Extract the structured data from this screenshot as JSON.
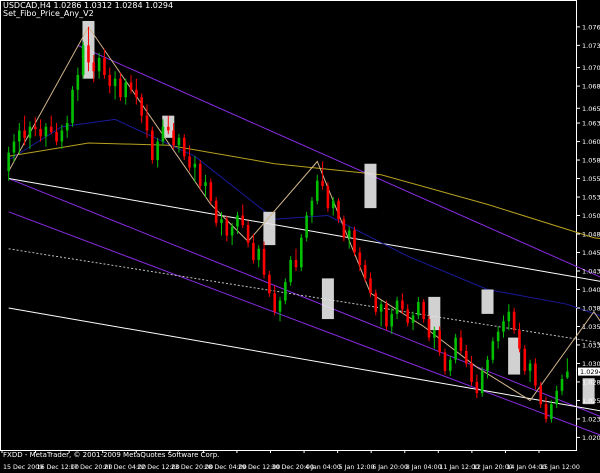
{
  "header": {
    "symbol_line": "USDCAD,H4  1.0286 1.0312 1.0284 1.0294",
    "indicator_line": "Set_Fibo_Price_Any_V2"
  },
  "footer": {
    "copyright": "FXDD - MetaTrader, © 2001-2009 MetaQuotes Software Corp."
  },
  "colors": {
    "background": "#000000",
    "bull": "#00c000",
    "bear": "#ff0000",
    "grid": "#ffffff",
    "channel_purple": "#8a2be2",
    "channel_white": "#ffffff",
    "ma_yellow": "#b8a020",
    "ma_navy": "#1a1a9a",
    "zigzag": "#d2b48c",
    "fibo_box": "#e8e8e8",
    "current_price": "#c0c0c0"
  },
  "chart_data": {
    "type": "candlestick",
    "title": "USDCAD,H4",
    "ohlc_header": {
      "open": 1.0286,
      "high": 1.0312,
      "low": 1.0284,
      "close": 1.0294
    },
    "current_price": 1.0294,
    "current_price_label": "1.0294",
    "ylim": [
      1.0188,
      1.0795
    ],
    "y_ticks": [
      {
        "value": 1.076,
        "label": "1.0760"
      },
      {
        "value": 1.0735,
        "label": "1.0735"
      },
      {
        "value": 1.0705,
        "label": "1.0705"
      },
      {
        "value": 1.068,
        "label": "1.0680"
      },
      {
        "value": 1.065,
        "label": "1.0650"
      },
      {
        "value": 1.063,
        "label": "1.0630"
      },
      {
        "value": 1.0605,
        "label": "1.0605"
      },
      {
        "value": 1.058,
        "label": "1.0580"
      },
      {
        "value": 1.0555,
        "label": "1.0555"
      },
      {
        "value": 1.053,
        "label": "1.0530"
      },
      {
        "value": 1.0505,
        "label": "1.0505"
      },
      {
        "value": 1.048,
        "label": "1.0480"
      },
      {
        "value": 1.0455,
        "label": "1.0455"
      },
      {
        "value": 1.043,
        "label": "1.0430"
      },
      {
        "value": 1.0405,
        "label": "1.0405"
      },
      {
        "value": 1.038,
        "label": "1.0380"
      },
      {
        "value": 1.0355,
        "label": "1.0355"
      },
      {
        "value": 1.033,
        "label": "1.0330"
      },
      {
        "value": 1.0305,
        "label": "1.0305"
      },
      {
        "value": 1.028,
        "label": "1.0280"
      },
      {
        "value": 1.0255,
        "label": "1.0255"
      },
      {
        "value": 1.023,
        "label": "1.0230"
      },
      {
        "value": 1.0205,
        "label": "1.0205"
      }
    ],
    "x_labels": [
      "15 Dec 2009",
      "16 Dec 12:00",
      "17 Dec 20:00",
      "21 Dec 04:00",
      "22 Dec 12:00",
      "23 Dec 20:00",
      "28 Dec 04:00",
      "29 Dec 12:00",
      "30 Dec 20:00",
      "4 Jan 04:00",
      "5 Jan 12:00",
      "6 Jan 20:00",
      "8 Jan 04:00",
      "11 Jan 12:00",
      "12 Jan 20:00",
      "14 Jan 04:00",
      "15 Jan 12:00"
    ],
    "candles": [
      [
        1.0565,
        1.0598,
        1.0552,
        1.059
      ],
      [
        1.059,
        1.0615,
        1.0578,
        1.0605
      ],
      [
        1.0605,
        1.063,
        1.0588,
        1.062
      ],
      [
        1.062,
        1.064,
        1.06,
        1.061
      ],
      [
        1.061,
        1.0632,
        1.0595,
        1.0625
      ],
      [
        1.0625,
        1.0638,
        1.0612,
        1.0622
      ],
      [
        1.0622,
        1.0635,
        1.0605,
        1.0612
      ],
      [
        1.0612,
        1.063,
        1.0598,
        1.0625
      ],
      [
        1.0625,
        1.064,
        1.0615,
        1.0618
      ],
      [
        1.0618,
        1.063,
        1.06,
        1.0605
      ],
      [
        1.0605,
        1.0628,
        1.0595,
        1.062
      ],
      [
        1.062,
        1.064,
        1.061,
        1.063
      ],
      [
        1.063,
        1.068,
        1.0625,
        1.0675
      ],
      [
        1.0675,
        1.0705,
        1.066,
        1.0695
      ],
      [
        1.0695,
        1.074,
        1.069,
        1.0735
      ],
      [
        1.0735,
        1.076,
        1.07,
        1.0712
      ],
      [
        1.0712,
        1.0722,
        1.0685,
        1.07
      ],
      [
        1.07,
        1.0725,
        1.069,
        1.0718
      ],
      [
        1.0718,
        1.073,
        1.069,
        1.0695
      ],
      [
        1.0695,
        1.0705,
        1.067,
        1.068
      ],
      [
        1.068,
        1.07,
        1.0662,
        1.069
      ],
      [
        1.069,
        1.0698,
        1.066,
        1.0665
      ],
      [
        1.0665,
        1.069,
        1.0655,
        1.0685
      ],
      [
        1.0685,
        1.0695,
        1.067,
        1.0675
      ],
      [
        1.0675,
        1.069,
        1.0655,
        1.0665
      ],
      [
        1.0665,
        1.067,
        1.063,
        1.064
      ],
      [
        1.064,
        1.0655,
        1.061,
        1.062
      ],
      [
        1.062,
        1.0625,
        1.0575,
        1.058
      ],
      [
        1.058,
        1.061,
        1.057,
        1.0605
      ],
      [
        1.0605,
        1.0635,
        1.06,
        1.0625
      ],
      [
        1.0625,
        1.064,
        1.0615,
        1.062
      ],
      [
        1.062,
        1.063,
        1.0595,
        1.06
      ],
      [
        1.06,
        1.0615,
        1.059,
        1.061
      ],
      [
        1.061,
        1.0615,
        1.058,
        1.0585
      ],
      [
        1.0585,
        1.06,
        1.0565,
        1.057
      ],
      [
        1.057,
        1.0585,
        1.055,
        1.0575
      ],
      [
        1.0575,
        1.058,
        1.054,
        1.0545
      ],
      [
        1.0545,
        1.056,
        1.053,
        1.055
      ],
      [
        1.055,
        1.0555,
        1.052,
        1.0525
      ],
      [
        1.0525,
        1.053,
        1.049,
        1.0495
      ],
      [
        1.0495,
        1.051,
        1.0478,
        1.05
      ],
      [
        1.05,
        1.0505,
        1.047,
        1.0478
      ],
      [
        1.0478,
        1.0495,
        1.0465,
        1.049
      ],
      [
        1.049,
        1.051,
        1.048,
        1.0505
      ],
      [
        1.0505,
        1.052,
        1.0488,
        1.0492
      ],
      [
        1.0492,
        1.0498,
        1.0462,
        1.0468
      ],
      [
        1.0468,
        1.048,
        1.044,
        1.0445
      ],
      [
        1.0445,
        1.0465,
        1.0435,
        1.046
      ],
      [
        1.046,
        1.047,
        1.042,
        1.0425
      ],
      [
        1.0425,
        1.043,
        1.0395,
        1.04
      ],
      [
        1.04,
        1.041,
        1.037,
        1.0375
      ],
      [
        1.0375,
        1.0395,
        1.0362,
        1.039
      ],
      [
        1.039,
        1.042,
        1.0385,
        1.0415
      ],
      [
        1.0415,
        1.045,
        1.041,
        1.0445
      ],
      [
        1.0445,
        1.046,
        1.043,
        1.0435
      ],
      [
        1.0435,
        1.048,
        1.043,
        1.0475
      ],
      [
        1.0475,
        1.051,
        1.047,
        1.0505
      ],
      [
        1.0505,
        1.053,
        1.0495,
        1.0525
      ],
      [
        1.0525,
        1.056,
        1.052,
        1.0552
      ],
      [
        1.0552,
        1.0578,
        1.054,
        1.0545
      ],
      [
        1.0545,
        1.055,
        1.051,
        1.0515
      ],
      [
        1.0515,
        1.053,
        1.0505,
        1.0525
      ],
      [
        1.0525,
        1.0528,
        1.0495,
        1.05
      ],
      [
        1.05,
        1.0505,
        1.047,
        1.0475
      ],
      [
        1.0475,
        1.049,
        1.046,
        1.0485
      ],
      [
        1.0485,
        1.049,
        1.045,
        1.0455
      ],
      [
        1.0455,
        1.0462,
        1.043,
        1.0438
      ],
      [
        1.0438,
        1.0445,
        1.0415,
        1.042
      ],
      [
        1.042,
        1.0428,
        1.0395,
        1.04
      ],
      [
        1.04,
        1.0405,
        1.037,
        1.0375
      ],
      [
        1.0375,
        1.039,
        1.0355,
        1.0385
      ],
      [
        1.0385,
        1.039,
        1.035,
        1.0355
      ],
      [
        1.0355,
        1.038,
        1.0345,
        1.0372
      ],
      [
        1.0372,
        1.0395,
        1.0365,
        1.039
      ],
      [
        1.039,
        1.04,
        1.0372,
        1.0378
      ],
      [
        1.0378,
        1.0385,
        1.0355,
        1.036
      ],
      [
        1.036,
        1.0375,
        1.035,
        1.037
      ],
      [
        1.037,
        1.0395,
        1.0365,
        1.0388
      ],
      [
        1.0388,
        1.0392,
        1.036,
        1.0365
      ],
      [
        1.0365,
        1.037,
        1.0335,
        1.034
      ],
      [
        1.034,
        1.0355,
        1.0325,
        1.035
      ],
      [
        1.035,
        1.0355,
        1.0315,
        1.032
      ],
      [
        1.032,
        1.0325,
        1.029,
        1.0295
      ],
      [
        1.0295,
        1.0315,
        1.0288,
        1.031
      ],
      [
        1.031,
        1.0345,
        1.0305,
        1.034
      ],
      [
        1.034,
        1.035,
        1.0318,
        1.0322
      ],
      [
        1.0322,
        1.033,
        1.03,
        1.0305
      ],
      [
        1.0305,
        1.0315,
        1.0275,
        1.028
      ],
      [
        1.028,
        1.029,
        1.0258,
        1.0265
      ],
      [
        1.0265,
        1.03,
        1.026,
        1.0295
      ],
      [
        1.0295,
        1.0315,
        1.0285,
        1.031
      ],
      [
        1.031,
        1.034,
        1.0305,
        1.0335
      ],
      [
        1.0335,
        1.0355,
        1.0325,
        1.0348
      ],
      [
        1.0348,
        1.037,
        1.034,
        1.0362
      ],
      [
        1.0362,
        1.0385,
        1.035,
        1.0375
      ],
      [
        1.0375,
        1.038,
        1.0345,
        1.035
      ],
      [
        1.035,
        1.036,
        1.032,
        1.0325
      ],
      [
        1.0325,
        1.033,
        1.029,
        1.0295
      ],
      [
        1.0295,
        1.031,
        1.028,
        1.0305
      ],
      [
        1.0305,
        1.0312,
        1.027,
        1.0275
      ],
      [
        1.0275,
        1.028,
        1.0245,
        1.025
      ],
      [
        1.025,
        1.026,
        1.0225,
        1.023
      ],
      [
        1.023,
        1.0255,
        1.0225,
        1.025
      ],
      [
        1.025,
        1.0275,
        1.0245,
        1.0268
      ],
      [
        1.0268,
        1.029,
        1.0262,
        1.0284
      ],
      [
        1.0286,
        1.0312,
        1.0284,
        1.0294
      ]
    ],
    "moving_averages": [
      {
        "color": "#b8a020",
        "values": [
          [
            0,
            1.0585
          ],
          [
            15,
            1.0603
          ],
          [
            30,
            1.06
          ],
          [
            50,
            1.0575
          ],
          [
            70,
            1.056
          ],
          [
            90,
            1.052
          ],
          [
            110,
            1.0475
          ],
          [
            140,
            1.0445
          ]
        ]
      },
      {
        "color": "#1a1a9a",
        "values": [
          [
            0,
            1.058
          ],
          [
            10,
            1.0625
          ],
          [
            20,
            1.0635
          ],
          [
            35,
            1.0585
          ],
          [
            50,
            1.05
          ],
          [
            60,
            1.0505
          ],
          [
            75,
            1.045
          ],
          [
            90,
            1.0405
          ],
          [
            105,
            1.0385
          ],
          [
            115,
            1.036
          ],
          [
            140,
            1.032
          ]
        ]
      }
    ],
    "channels": [
      {
        "color": "#8a2be2",
        "from": [
          13,
          1.0735
        ],
        "to": [
          140,
          1.033
        ]
      },
      {
        "color": "#8a2be2",
        "from": [
          0,
          1.051
        ],
        "to": [
          140,
          1.013
        ]
      },
      {
        "color": "#8a2be2",
        "from": [
          0,
          1.0555
        ],
        "to": [
          140,
          1.015
        ]
      },
      {
        "color": "#ffffff",
        "from": [
          0,
          1.0555
        ],
        "to": [
          140,
          1.038
        ]
      },
      {
        "color": "#ffffff",
        "from": [
          0,
          1.038
        ],
        "to": [
          140,
          1.0205
        ]
      },
      {
        "color": "#c0c0c0",
        "dashed": true,
        "from": [
          0,
          1.046
        ],
        "to": [
          140,
          1.03
        ]
      }
    ],
    "zigzag": [
      [
        0,
        1.0565
      ],
      [
        15,
        1.076
      ],
      [
        38,
        1.052
      ],
      [
        45,
        1.047
      ],
      [
        58,
        1.0578
      ],
      [
        68,
        1.04
      ],
      [
        78,
        1.0355
      ],
      [
        88,
        1.03
      ],
      [
        98,
        1.0255
      ],
      [
        110,
        1.0375
      ],
      [
        124,
        1.0225
      ],
      [
        140,
        1.03
      ]
    ],
    "fibo_boxes": [
      {
        "center": 15,
        "low": 1.069,
        "high": 1.0768
      },
      {
        "center": 30,
        "low": 1.061,
        "high": 1.064
      },
      {
        "center": 49,
        "low": 1.0465,
        "high": 1.051
      },
      {
        "center": 60,
        "low": 1.0365,
        "high": 1.042
      },
      {
        "center": 68,
        "low": 1.0515,
        "high": 1.0575
      },
      {
        "center": 80,
        "low": 1.035,
        "high": 1.0395
      },
      {
        "center": 90,
        "low": 1.0372,
        "high": 1.0405
      },
      {
        "center": 95,
        "low": 1.029,
        "high": 1.034
      },
      {
        "center": 109,
        "low": 1.025,
        "high": 1.0285
      },
      {
        "center": 118,
        "low": 1.0352,
        "high": 1.0378
      },
      {
        "center": 125,
        "low": 1.027,
        "high": 1.031
      },
      {
        "center": 132,
        "low": 1.0218,
        "high": 1.0248
      }
    ]
  }
}
